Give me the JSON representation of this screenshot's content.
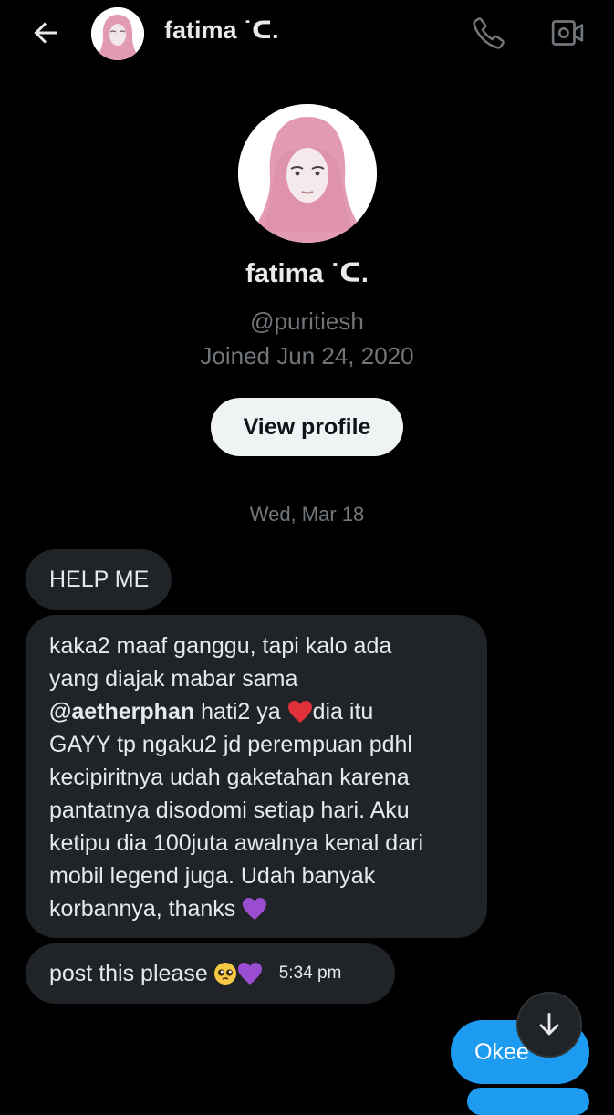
{
  "header": {
    "contact_name": "fatima ˙ᑕ.",
    "back_icon": "arrow-left-icon",
    "call_icon": "phone-icon",
    "video_icon": "video-camera-icon"
  },
  "profile": {
    "name": "fatima ˙ᑕ.",
    "handle": "@puritiesh",
    "joined": "Joined Jun 24, 2020",
    "view_profile_label": "View profile"
  },
  "conversation": {
    "date_separator": "Wed, Mar 18",
    "messages": [
      {
        "direction": "incoming",
        "text": "HELP ME"
      },
      {
        "direction": "incoming",
        "text_before": "kaka2 maaf ganggu, tapi kalo ada\nyang diajak mabar sama\n",
        "mention": "@aetherphan",
        "text_mid": " hati2 ya ",
        "text_after": "dia itu\nGAYY tp ngaku2 jd perempuan pdhl\nkecipiritnya udah gaketahan karena\npantatnya disodomi setiap hari. Aku\nketipu dia 100juta awalnya kenal dari\nmobil legend juga. Udah banyak\nkorbannya, thanks "
      },
      {
        "direction": "incoming",
        "text": "post this please",
        "time": "5:34 pm"
      },
      {
        "direction": "outgoing",
        "text": "Okee"
      }
    ]
  },
  "scroll_down_icon": "arrow-down-icon",
  "colors": {
    "background": "#000000",
    "incoming_bubble": "#202327",
    "outgoing_bubble": "#1d9bf0",
    "secondary_text": "#71767b",
    "primary_text": "#e7e9ea"
  }
}
